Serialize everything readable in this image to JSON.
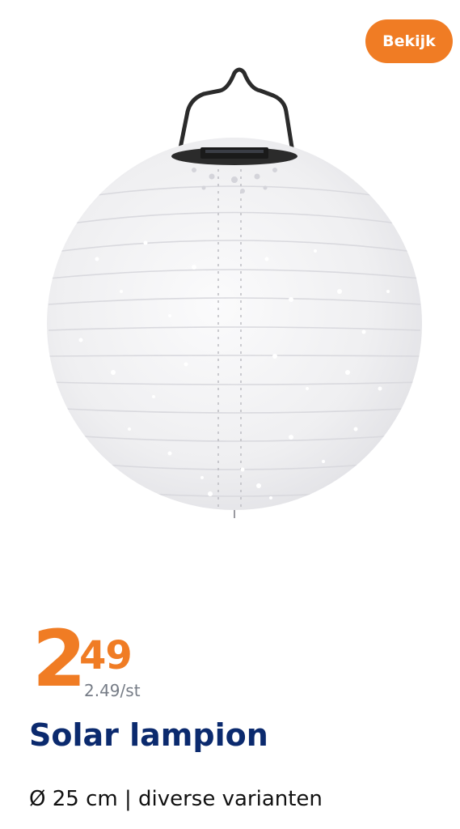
{
  "action": {
    "view_label": "Bekijk"
  },
  "product": {
    "price_whole": "2",
    "price_decimal": "49",
    "unit_price": "2.49/st",
    "title": "Solar lampion",
    "subtitle": "Ø 25 cm | diverse varianten",
    "image": "white solar paper lantern with perforated pattern and black wire hanger"
  },
  "colors": {
    "accent": "#f07c24",
    "title": "#0b2a6e",
    "muted": "#767c86"
  }
}
